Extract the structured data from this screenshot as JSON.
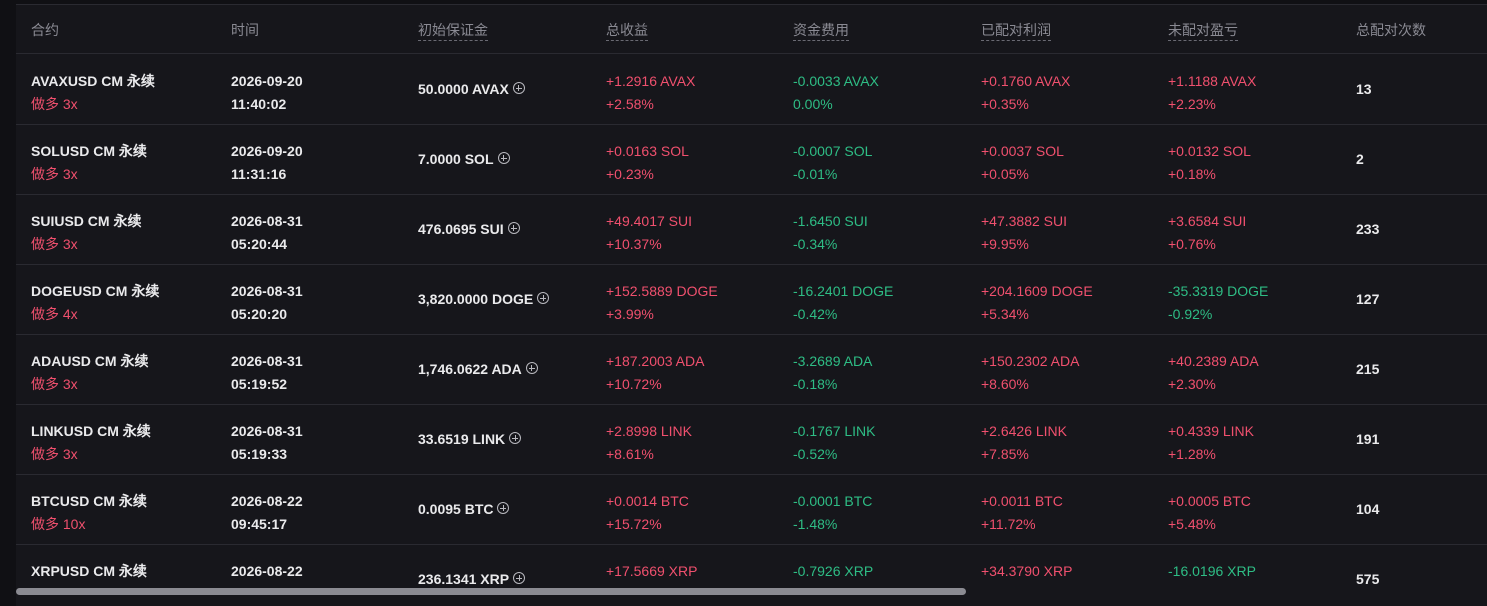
{
  "columns": {
    "contract": "合约",
    "time": "时间",
    "initial_margin": "初始保证金",
    "total_pnl": "总收益",
    "funding_fee": "资金费用",
    "matched_profit": "已配对利润",
    "unmatched_pnl": "未配对盈亏",
    "total_matches": "总配对次数"
  },
  "rows": [
    {
      "symbol": "AVAXUSD CM 永续",
      "side": "做多 3x",
      "date": "2026-09-20",
      "clock": "11:40:02",
      "margin": "50.0000 AVAX",
      "pnl": "+1.2916 AVAX",
      "pnl_pct": "+2.58%",
      "pnl_dir": "up",
      "funding": "-0.0033 AVAX",
      "funding_pct": "0.00%",
      "funding_dir": "down",
      "matched": "+0.1760 AVAX",
      "matched_pct": "+0.35%",
      "matched_dir": "up",
      "unmatched": "+1.1188 AVAX",
      "unmatched_pct": "+2.23%",
      "unmatched_dir": "up",
      "count": "13"
    },
    {
      "symbol": "SOLUSD CM 永续",
      "side": "做多 3x",
      "date": "2026-09-20",
      "clock": "11:31:16",
      "margin": "7.0000 SOL",
      "pnl": "+0.0163 SOL",
      "pnl_pct": "+0.23%",
      "pnl_dir": "up",
      "funding": "-0.0007 SOL",
      "funding_pct": "-0.01%",
      "funding_dir": "down",
      "matched": "+0.0037 SOL",
      "matched_pct": "+0.05%",
      "matched_dir": "up",
      "unmatched": "+0.0132 SOL",
      "unmatched_pct": "+0.18%",
      "unmatched_dir": "up",
      "count": "2"
    },
    {
      "symbol": "SUIUSD CM 永续",
      "side": "做多 3x",
      "date": "2026-08-31",
      "clock": "05:20:44",
      "margin": "476.0695 SUI",
      "pnl": "+49.4017 SUI",
      "pnl_pct": "+10.37%",
      "pnl_dir": "up",
      "funding": "-1.6450 SUI",
      "funding_pct": "-0.34%",
      "funding_dir": "down",
      "matched": "+47.3882 SUI",
      "matched_pct": "+9.95%",
      "matched_dir": "up",
      "unmatched": "+3.6584 SUI",
      "unmatched_pct": "+0.76%",
      "unmatched_dir": "up",
      "count": "233"
    },
    {
      "symbol": "DOGEUSD CM 永续",
      "side": "做多 4x",
      "date": "2026-08-31",
      "clock": "05:20:20",
      "margin": "3,820.0000 DOGE",
      "pnl": "+152.5889 DOGE",
      "pnl_pct": "+3.99%",
      "pnl_dir": "up",
      "funding": "-16.2401 DOGE",
      "funding_pct": "-0.42%",
      "funding_dir": "down",
      "matched": "+204.1609 DOGE",
      "matched_pct": "+5.34%",
      "matched_dir": "up",
      "unmatched": "-35.3319 DOGE",
      "unmatched_pct": "-0.92%",
      "unmatched_dir": "down",
      "count": "127"
    },
    {
      "symbol": "ADAUSD CM 永续",
      "side": "做多 3x",
      "date": "2026-08-31",
      "clock": "05:19:52",
      "margin": "1,746.0622 ADA",
      "pnl": "+187.2003 ADA",
      "pnl_pct": "+10.72%",
      "pnl_dir": "up",
      "funding": "-3.2689 ADA",
      "funding_pct": "-0.18%",
      "funding_dir": "down",
      "matched": "+150.2302 ADA",
      "matched_pct": "+8.60%",
      "matched_dir": "up",
      "unmatched": "+40.2389 ADA",
      "unmatched_pct": "+2.30%",
      "unmatched_dir": "up",
      "count": "215"
    },
    {
      "symbol": "LINKUSD CM 永续",
      "side": "做多 3x",
      "date": "2026-08-31",
      "clock": "05:19:33",
      "margin": "33.6519 LINK",
      "pnl": "+2.8998 LINK",
      "pnl_pct": "+8.61%",
      "pnl_dir": "up",
      "funding": "-0.1767 LINK",
      "funding_pct": "-0.52%",
      "funding_dir": "down",
      "matched": "+2.6426 LINK",
      "matched_pct": "+7.85%",
      "matched_dir": "up",
      "unmatched": "+0.4339 LINK",
      "unmatched_pct": "+1.28%",
      "unmatched_dir": "up",
      "count": "191"
    },
    {
      "symbol": "BTCUSD CM 永续",
      "side": "做多 10x",
      "date": "2026-08-22",
      "clock": "09:45:17",
      "margin": "0.0095 BTC",
      "pnl": "+0.0014 BTC",
      "pnl_pct": "+15.72%",
      "pnl_dir": "up",
      "funding": "-0.0001 BTC",
      "funding_pct": "-1.48%",
      "funding_dir": "down",
      "matched": "+0.0011 BTC",
      "matched_pct": "+11.72%",
      "matched_dir": "up",
      "unmatched": "+0.0005 BTC",
      "unmatched_pct": "+5.48%",
      "unmatched_dir": "up",
      "count": "104"
    },
    {
      "symbol": "XRPUSD CM 永续",
      "side": "",
      "date": "2026-08-22",
      "clock": "",
      "margin": "236.1341 XRP",
      "pnl": "+17.5669 XRP",
      "pnl_pct": "",
      "pnl_dir": "up",
      "funding": "-0.7926 XRP",
      "funding_pct": "",
      "funding_dir": "down",
      "matched": "+34.3790 XRP",
      "matched_pct": "",
      "matched_dir": "up",
      "unmatched": "-16.0196 XRP",
      "unmatched_pct": "",
      "unmatched_dir": "down",
      "count": "575"
    }
  ],
  "colors": {
    "up": "#f0506e",
    "down": "#2ebd85",
    "text": "#eaeaec",
    "muted": "#8a8a93"
  },
  "icons": {
    "add_margin": "plus-circle-icon"
  },
  "scroll": {
    "horizontal_fraction": 0.646
  }
}
